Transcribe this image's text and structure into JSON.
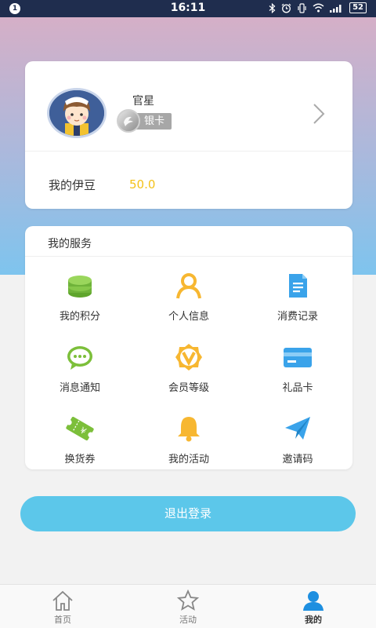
{
  "status_bar": {
    "notification_count": "1",
    "time": "16:11",
    "battery": "52",
    "icons": [
      "bluetooth-icon",
      "alarm-icon",
      "vibrate-icon",
      "wifi-icon",
      "signal-icon",
      "battery-icon"
    ]
  },
  "profile": {
    "name": "官星",
    "level": "银卡",
    "points_label": "我的伊豆",
    "points_value": "50.0"
  },
  "services": {
    "title": "我的服务",
    "items": [
      {
        "label": "我的积分",
        "icon": "coin-stack-icon",
        "color": "#7cbf3a"
      },
      {
        "label": "个人信息",
        "icon": "person-icon",
        "color": "#f7b731"
      },
      {
        "label": "消费记录",
        "icon": "document-icon",
        "color": "#3aa3ea"
      },
      {
        "label": "消息通知",
        "icon": "chat-bubble-icon",
        "color": "#7cbf3a"
      },
      {
        "label": "会员等级",
        "icon": "vip-badge-icon",
        "color": "#f7b731"
      },
      {
        "label": "礼品卡",
        "icon": "card-icon",
        "color": "#3aa3ea"
      },
      {
        "label": "换货券",
        "icon": "ticket-icon",
        "color": "#7cbf3a"
      },
      {
        "label": "我的活动",
        "icon": "bell-icon",
        "color": "#f7b731"
      },
      {
        "label": "邀请码",
        "icon": "paper-plane-icon",
        "color": "#3aa3ea"
      }
    ]
  },
  "logout_label": "退出登录",
  "nav": {
    "items": [
      {
        "label": "首页",
        "icon": "home-icon"
      },
      {
        "label": "活动",
        "icon": "star-icon"
      },
      {
        "label": "我的",
        "icon": "user-icon",
        "active": true
      }
    ]
  },
  "colors": {
    "accent": "#5cc7ea",
    "points": "#f4c21a",
    "gradient_top": "#d5afc7",
    "gradient_bottom": "#7ec4ee"
  }
}
